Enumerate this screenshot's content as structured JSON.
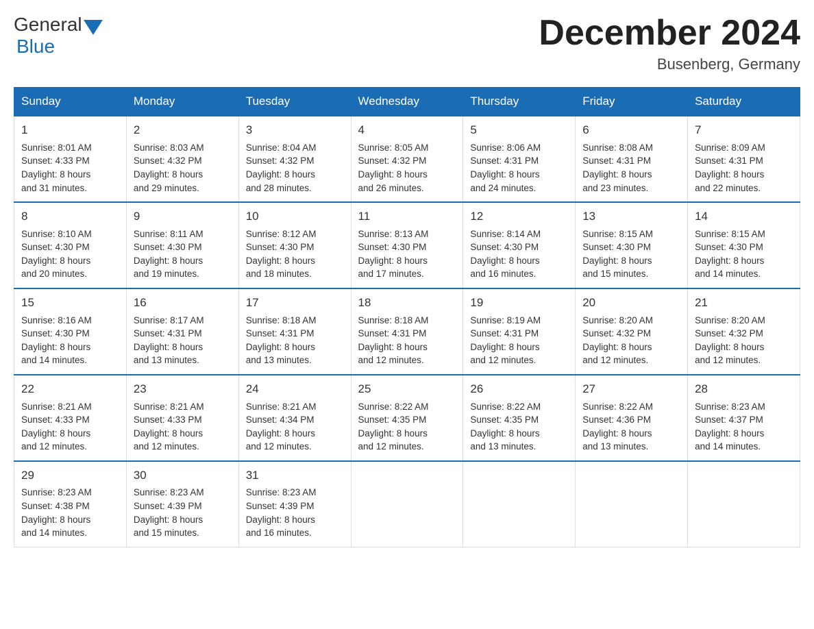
{
  "header": {
    "logo_general": "General",
    "logo_blue": "Blue",
    "title": "December 2024",
    "subtitle": "Busenberg, Germany"
  },
  "weekdays": [
    "Sunday",
    "Monday",
    "Tuesday",
    "Wednesday",
    "Thursday",
    "Friday",
    "Saturday"
  ],
  "weeks": [
    [
      {
        "day": "1",
        "line1": "Sunrise: 8:01 AM",
        "line2": "Sunset: 4:33 PM",
        "line3": "Daylight: 8 hours",
        "line4": "and 31 minutes."
      },
      {
        "day": "2",
        "line1": "Sunrise: 8:03 AM",
        "line2": "Sunset: 4:32 PM",
        "line3": "Daylight: 8 hours",
        "line4": "and 29 minutes."
      },
      {
        "day": "3",
        "line1": "Sunrise: 8:04 AM",
        "line2": "Sunset: 4:32 PM",
        "line3": "Daylight: 8 hours",
        "line4": "and 28 minutes."
      },
      {
        "day": "4",
        "line1": "Sunrise: 8:05 AM",
        "line2": "Sunset: 4:32 PM",
        "line3": "Daylight: 8 hours",
        "line4": "and 26 minutes."
      },
      {
        "day": "5",
        "line1": "Sunrise: 8:06 AM",
        "line2": "Sunset: 4:31 PM",
        "line3": "Daylight: 8 hours",
        "line4": "and 24 minutes."
      },
      {
        "day": "6",
        "line1": "Sunrise: 8:08 AM",
        "line2": "Sunset: 4:31 PM",
        "line3": "Daylight: 8 hours",
        "line4": "and 23 minutes."
      },
      {
        "day": "7",
        "line1": "Sunrise: 8:09 AM",
        "line2": "Sunset: 4:31 PM",
        "line3": "Daylight: 8 hours",
        "line4": "and 22 minutes."
      }
    ],
    [
      {
        "day": "8",
        "line1": "Sunrise: 8:10 AM",
        "line2": "Sunset: 4:30 PM",
        "line3": "Daylight: 8 hours",
        "line4": "and 20 minutes."
      },
      {
        "day": "9",
        "line1": "Sunrise: 8:11 AM",
        "line2": "Sunset: 4:30 PM",
        "line3": "Daylight: 8 hours",
        "line4": "and 19 minutes."
      },
      {
        "day": "10",
        "line1": "Sunrise: 8:12 AM",
        "line2": "Sunset: 4:30 PM",
        "line3": "Daylight: 8 hours",
        "line4": "and 18 minutes."
      },
      {
        "day": "11",
        "line1": "Sunrise: 8:13 AM",
        "line2": "Sunset: 4:30 PM",
        "line3": "Daylight: 8 hours",
        "line4": "and 17 minutes."
      },
      {
        "day": "12",
        "line1": "Sunrise: 8:14 AM",
        "line2": "Sunset: 4:30 PM",
        "line3": "Daylight: 8 hours",
        "line4": "and 16 minutes."
      },
      {
        "day": "13",
        "line1": "Sunrise: 8:15 AM",
        "line2": "Sunset: 4:30 PM",
        "line3": "Daylight: 8 hours",
        "line4": "and 15 minutes."
      },
      {
        "day": "14",
        "line1": "Sunrise: 8:15 AM",
        "line2": "Sunset: 4:30 PM",
        "line3": "Daylight: 8 hours",
        "line4": "and 14 minutes."
      }
    ],
    [
      {
        "day": "15",
        "line1": "Sunrise: 8:16 AM",
        "line2": "Sunset: 4:30 PM",
        "line3": "Daylight: 8 hours",
        "line4": "and 14 minutes."
      },
      {
        "day": "16",
        "line1": "Sunrise: 8:17 AM",
        "line2": "Sunset: 4:31 PM",
        "line3": "Daylight: 8 hours",
        "line4": "and 13 minutes."
      },
      {
        "day": "17",
        "line1": "Sunrise: 8:18 AM",
        "line2": "Sunset: 4:31 PM",
        "line3": "Daylight: 8 hours",
        "line4": "and 13 minutes."
      },
      {
        "day": "18",
        "line1": "Sunrise: 8:18 AM",
        "line2": "Sunset: 4:31 PM",
        "line3": "Daylight: 8 hours",
        "line4": "and 12 minutes."
      },
      {
        "day": "19",
        "line1": "Sunrise: 8:19 AM",
        "line2": "Sunset: 4:31 PM",
        "line3": "Daylight: 8 hours",
        "line4": "and 12 minutes."
      },
      {
        "day": "20",
        "line1": "Sunrise: 8:20 AM",
        "line2": "Sunset: 4:32 PM",
        "line3": "Daylight: 8 hours",
        "line4": "and 12 minutes."
      },
      {
        "day": "21",
        "line1": "Sunrise: 8:20 AM",
        "line2": "Sunset: 4:32 PM",
        "line3": "Daylight: 8 hours",
        "line4": "and 12 minutes."
      }
    ],
    [
      {
        "day": "22",
        "line1": "Sunrise: 8:21 AM",
        "line2": "Sunset: 4:33 PM",
        "line3": "Daylight: 8 hours",
        "line4": "and 12 minutes."
      },
      {
        "day": "23",
        "line1": "Sunrise: 8:21 AM",
        "line2": "Sunset: 4:33 PM",
        "line3": "Daylight: 8 hours",
        "line4": "and 12 minutes."
      },
      {
        "day": "24",
        "line1": "Sunrise: 8:21 AM",
        "line2": "Sunset: 4:34 PM",
        "line3": "Daylight: 8 hours",
        "line4": "and 12 minutes."
      },
      {
        "day": "25",
        "line1": "Sunrise: 8:22 AM",
        "line2": "Sunset: 4:35 PM",
        "line3": "Daylight: 8 hours",
        "line4": "and 12 minutes."
      },
      {
        "day": "26",
        "line1": "Sunrise: 8:22 AM",
        "line2": "Sunset: 4:35 PM",
        "line3": "Daylight: 8 hours",
        "line4": "and 13 minutes."
      },
      {
        "day": "27",
        "line1": "Sunrise: 8:22 AM",
        "line2": "Sunset: 4:36 PM",
        "line3": "Daylight: 8 hours",
        "line4": "and 13 minutes."
      },
      {
        "day": "28",
        "line1": "Sunrise: 8:23 AM",
        "line2": "Sunset: 4:37 PM",
        "line3": "Daylight: 8 hours",
        "line4": "and 14 minutes."
      }
    ],
    [
      {
        "day": "29",
        "line1": "Sunrise: 8:23 AM",
        "line2": "Sunset: 4:38 PM",
        "line3": "Daylight: 8 hours",
        "line4": "and 14 minutes."
      },
      {
        "day": "30",
        "line1": "Sunrise: 8:23 AM",
        "line2": "Sunset: 4:39 PM",
        "line3": "Daylight: 8 hours",
        "line4": "and 15 minutes."
      },
      {
        "day": "31",
        "line1": "Sunrise: 8:23 AM",
        "line2": "Sunset: 4:39 PM",
        "line3": "Daylight: 8 hours",
        "line4": "and 16 minutes."
      },
      {
        "day": "",
        "line1": "",
        "line2": "",
        "line3": "",
        "line4": ""
      },
      {
        "day": "",
        "line1": "",
        "line2": "",
        "line3": "",
        "line4": ""
      },
      {
        "day": "",
        "line1": "",
        "line2": "",
        "line3": "",
        "line4": ""
      },
      {
        "day": "",
        "line1": "",
        "line2": "",
        "line3": "",
        "line4": ""
      }
    ]
  ]
}
